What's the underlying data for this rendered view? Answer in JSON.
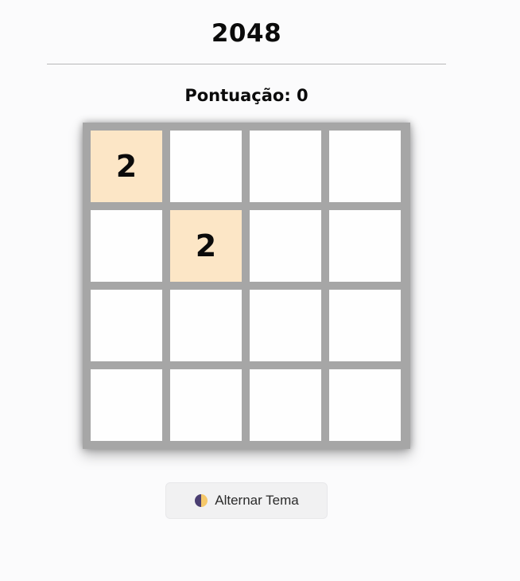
{
  "game": {
    "title": "2048",
    "score_label": "Pontuação: 0"
  },
  "board": {
    "size": 4,
    "cells": [
      [
        "2",
        "",
        "",
        ""
      ],
      [
        "",
        "2",
        "",
        ""
      ],
      [
        "",
        "",
        "",
        ""
      ],
      [
        "",
        "",
        "",
        ""
      ]
    ]
  },
  "theme_button": {
    "label": "Alternar Tema",
    "icon": "half-moon-theme-icon"
  },
  "colors": {
    "background": "#fbfbfc",
    "board": "#a6a6a6",
    "empty_cell": "#fefefe",
    "tile_2": "#fce6c6",
    "icon_dark": "#4b3f72",
    "icon_light": "#f5c86a"
  }
}
